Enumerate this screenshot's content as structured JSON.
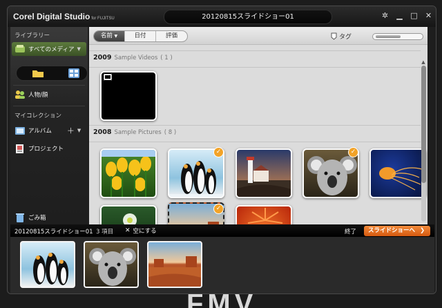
{
  "window": {
    "brand": "Corel Digital Studio",
    "brand_sub": "for FUJITSU",
    "title": "20120815スライドショー01"
  },
  "desktop_text": "FMV",
  "sidebar": {
    "library_heading": "ライブラリー",
    "all_media": "すべてのメディア",
    "people": "人物/顔",
    "collection_heading": "マイコレクション",
    "album": "アルバム",
    "project": "プロジェクト",
    "trash": "ごみ箱"
  },
  "toolbar": {
    "sort_name": "名前",
    "sort_date": "日付",
    "sort_rating": "評価",
    "tag": "タグ"
  },
  "groups": [
    {
      "year": "2009",
      "name": "Sample Videos",
      "count": "( 1 )"
    },
    {
      "year": "2008",
      "name": "Sample Pictures",
      "count": "( 8 )"
    }
  ],
  "thumbnails": [
    {
      "name": "video-1",
      "kind": "video",
      "selected": false
    },
    {
      "name": "tulips",
      "kind": "photo",
      "selected": false
    },
    {
      "name": "penguins",
      "kind": "photo",
      "selected": true
    },
    {
      "name": "lighthouse",
      "kind": "photo",
      "selected": false
    },
    {
      "name": "koala",
      "kind": "photo",
      "selected": true
    },
    {
      "name": "jellyfish",
      "kind": "photo",
      "selected": false
    },
    {
      "name": "chrysanthemum-green",
      "kind": "photo",
      "selected": false
    },
    {
      "name": "desert",
      "kind": "photo",
      "selected": true
    },
    {
      "name": "chrysanthemum",
      "kind": "photo",
      "selected": false
    }
  ],
  "tray": {
    "title": "20120815スライドショー01",
    "count": "3 項目",
    "clear": "空にする",
    "end": "終了",
    "slideshow_button": "スライドショーへ"
  },
  "colors": {
    "accent_orange": "#f2a328",
    "slideshow_button": "#e06a1a",
    "sidebar_highlight": "#5c7a3c"
  }
}
